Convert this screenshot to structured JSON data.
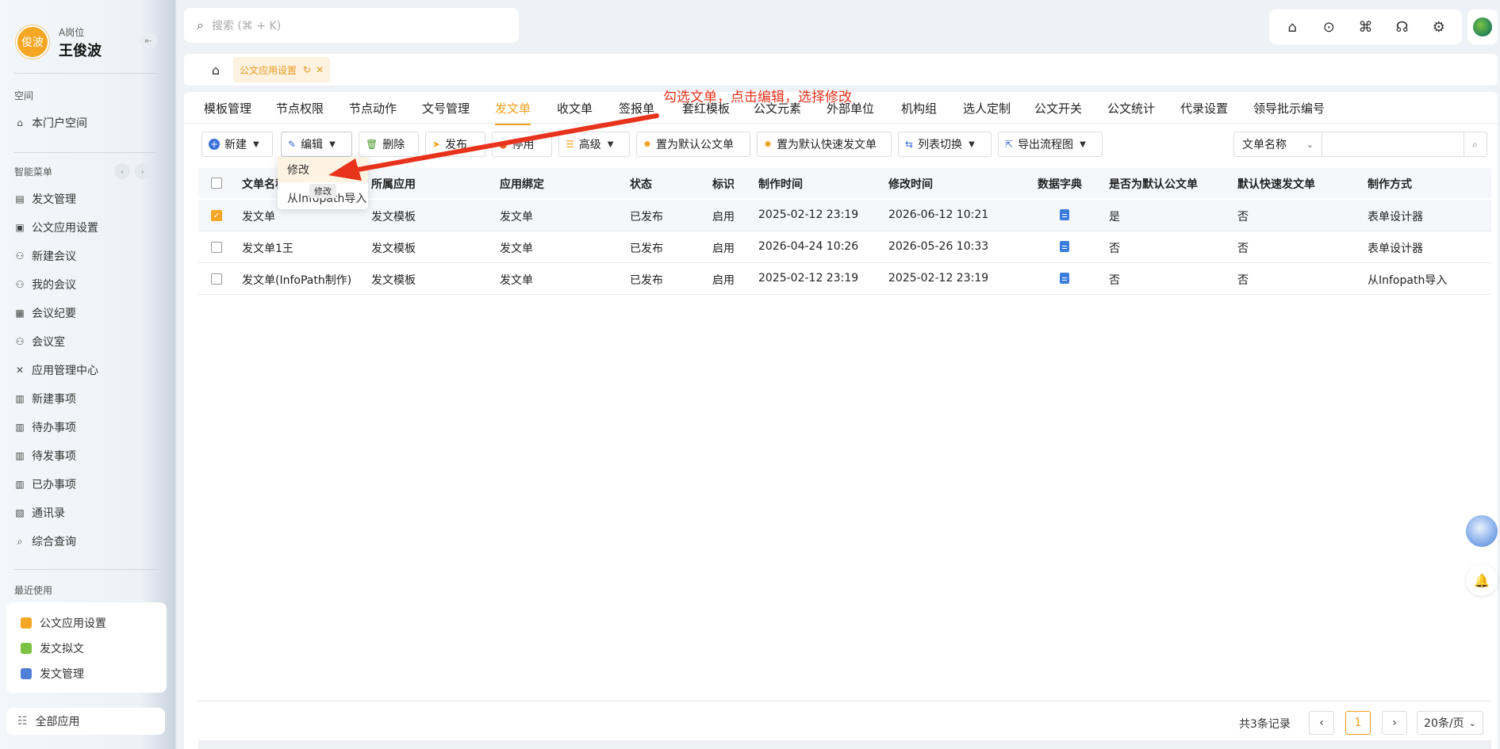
{
  "user": {
    "avatar_text": "俊波",
    "role": "A岗位",
    "name": "王俊波"
  },
  "sidebar": {
    "space_title": "空间",
    "portal": "本门户空间",
    "menu_title": "智能菜单",
    "items": [
      {
        "label": "发文管理",
        "icon": "doc-icon"
      },
      {
        "label": "公文应用设置",
        "icon": "doc-settings-icon"
      },
      {
        "label": "新建会议",
        "icon": "people-icon"
      },
      {
        "label": "我的会议",
        "icon": "people-icon"
      },
      {
        "label": "会议纪要",
        "icon": "notes-icon"
      },
      {
        "label": "会议室",
        "icon": "people-icon"
      },
      {
        "label": "应用管理中心",
        "icon": "tools-icon"
      },
      {
        "label": "新建事项",
        "icon": "task-icon"
      },
      {
        "label": "待办事项",
        "icon": "task-icon"
      },
      {
        "label": "待发事项",
        "icon": "task-icon"
      },
      {
        "label": "已办事项",
        "icon": "task-icon"
      },
      {
        "label": "通讯录",
        "icon": "contacts-icon"
      },
      {
        "label": "综合查询",
        "icon": "search-icon"
      }
    ],
    "recent_title": "最近使用",
    "recent": [
      {
        "label": "公文应用设置",
        "color": "#f5a623"
      },
      {
        "label": "发文拟文",
        "color": "#7cc243"
      },
      {
        "label": "发文管理",
        "color": "#4f7fd6"
      }
    ],
    "all_apps": "全部应用"
  },
  "search": {
    "placeholder": "搜索 (⌘ + K)"
  },
  "tabs": {
    "active": "公文应用设置"
  },
  "subtabs": [
    "模板管理",
    "节点权限",
    "节点动作",
    "文号管理",
    "发文单",
    "收文单",
    "签报单",
    "套红模板",
    "公文元素",
    "外部单位",
    "机构组",
    "选人定制",
    "公文开关",
    "公文统计",
    "代录设置",
    "领导批示编号"
  ],
  "active_subtab": "发文单",
  "annotation": "勾选文单，点击编辑，选择修改",
  "toolbar": {
    "new": "新建",
    "edit": "编辑",
    "delete": "删除",
    "publish": "发布",
    "disable": "停用",
    "advanced": "高级",
    "set_default": "置为默认公文单",
    "set_default_fast": "置为默认快速发文单",
    "list_switch": "列表切换",
    "export_flow": "导出流程图"
  },
  "query": {
    "field": "文单名称"
  },
  "dropdown": {
    "modify": "修改",
    "import": "从Infopath导入",
    "tooltip": "修改"
  },
  "table": {
    "headers": [
      "文单名称",
      "所属应用",
      "应用绑定",
      "状态",
      "标识",
      "制作时间",
      "修改时间",
      "数据字典",
      "是否为默认公文单",
      "默认快速发文单",
      "制作方式"
    ],
    "rows": [
      {
        "name": "发文单",
        "app": "发文模板",
        "bind": "发文单",
        "status": "已发布",
        "flag": "启用",
        "created": "2025-02-12 23:19",
        "modified": "2026-06-12 10:21",
        "is_default": "是",
        "fast_default": "否",
        "method": "表单设计器",
        "checked": true
      },
      {
        "name": "发文单1王",
        "app": "发文模板",
        "bind": "发文单",
        "status": "已发布",
        "flag": "启用",
        "created": "2026-04-24 10:26",
        "modified": "2026-05-26 10:33",
        "is_default": "否",
        "fast_default": "否",
        "method": "表单设计器",
        "checked": false
      },
      {
        "name": "发文单(InfoPath制作)",
        "app": "发文模板",
        "bind": "发文单",
        "status": "已发布",
        "flag": "启用",
        "created": "2025-02-12 23:19",
        "modified": "2025-02-12 23:19",
        "is_default": "否",
        "fast_default": "否",
        "method": "从Infopath导入",
        "checked": false
      }
    ]
  },
  "pager": {
    "total": "共3条记录",
    "current": "1",
    "page_size": "20条/页"
  },
  "colors": {
    "accent": "#f0a020",
    "annotation": "#e8331c",
    "link": "#3b7ddd"
  }
}
